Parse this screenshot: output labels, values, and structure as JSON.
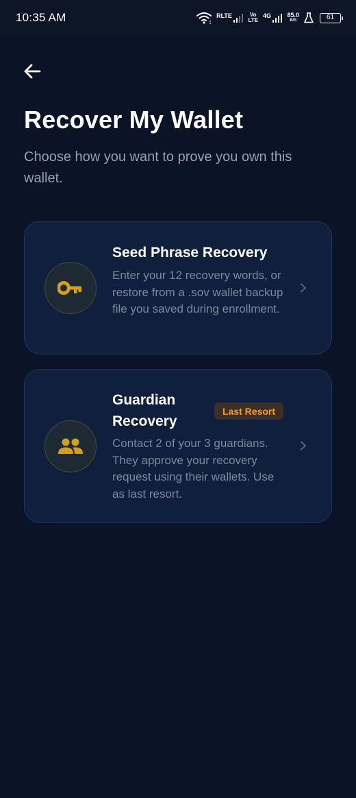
{
  "status_bar": {
    "time": "10:35 AM",
    "network_1": "RLTE",
    "volte_top": "Vo",
    "volte_bottom": "LTE",
    "network_2": "4G",
    "speed_value": "85.0",
    "speed_unit": "B/S",
    "battery_level": "61",
    "icons": [
      "wifi-icon",
      "signal-icon",
      "signal-icon",
      "flask-icon",
      "battery-icon"
    ]
  },
  "header": {
    "back_icon": "arrow-left-icon",
    "title": "Recover My Wallet",
    "subtitle": "Choose how you want to prove you own this wallet."
  },
  "options": {
    "seed": {
      "title": "Seed Phrase Recovery",
      "description": "Enter your 12 recovery words, or restore from a .sov wallet backup file you saved during enrollment.",
      "icon": "key-icon"
    },
    "guardian": {
      "title": "Guardian Recovery",
      "badge": "Last Resort",
      "description": "Contact 2 of your 3 guardians. They approve your recovery request using their wallets. Use as last resort.",
      "icon": "group-icon"
    }
  },
  "colors": {
    "background": "#0a1426",
    "card": "#0f1f3d",
    "card_border": "#22355a",
    "accent_gold": "#d4a017",
    "badge_text": "#f39b2b",
    "muted_text": "#7f889c"
  }
}
